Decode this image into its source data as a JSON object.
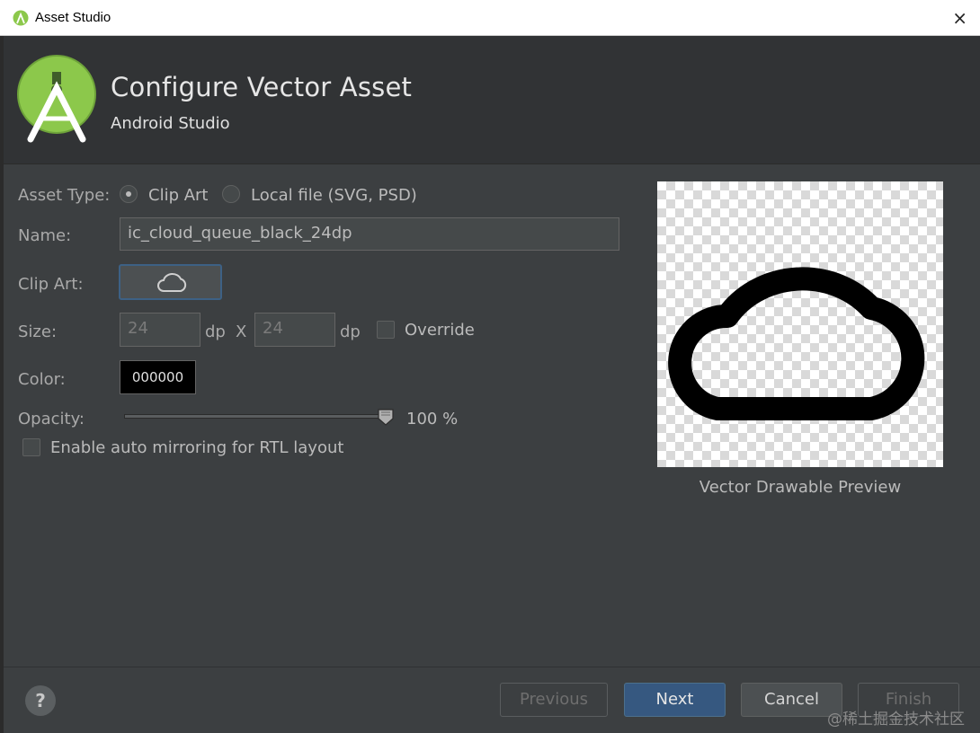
{
  "window": {
    "title": "Asset Studio",
    "close_glyph": "×"
  },
  "header": {
    "title": "Configure Vector Asset",
    "subtitle": "Android Studio",
    "logo_icon": "android-studio-logo-icon"
  },
  "form": {
    "asset_type_label": "Asset Type:",
    "asset_type_options": [
      {
        "label": "Clip Art",
        "checked": true
      },
      {
        "label": "Local file (SVG, PSD)",
        "checked": false
      }
    ],
    "name_label": "Name:",
    "name_value": "ic_cloud_queue_black_24dp",
    "clip_art_label": "Clip Art:",
    "clip_art_icon": "cloud-outline-icon",
    "size_label": "Size:",
    "size_width": "24",
    "size_height": "24",
    "size_unit": "dp",
    "size_x": "X",
    "override_label": "Override",
    "override_checked": false,
    "color_label": "Color:",
    "color_value": "000000",
    "opacity_label": "Opacity:",
    "opacity_value": "100 %",
    "opacity_fraction": 1.0,
    "auto_mirror_label": "Enable auto mirroring for RTL layout",
    "auto_mirror_checked": false
  },
  "preview": {
    "caption": "Vector Drawable Preview",
    "icon": "cloud-outline-icon",
    "fill_color": "#000000"
  },
  "footer": {
    "help_glyph": "?",
    "previous_label": "Previous",
    "next_label": "Next",
    "cancel_label": "Cancel",
    "finish_label": "Finish"
  },
  "watermark": "@稀土掘金技术社区",
  "colors": {
    "background": "#3c3f41",
    "header": "#313335",
    "accent": "#365880",
    "android_green": "#8cc84b"
  }
}
